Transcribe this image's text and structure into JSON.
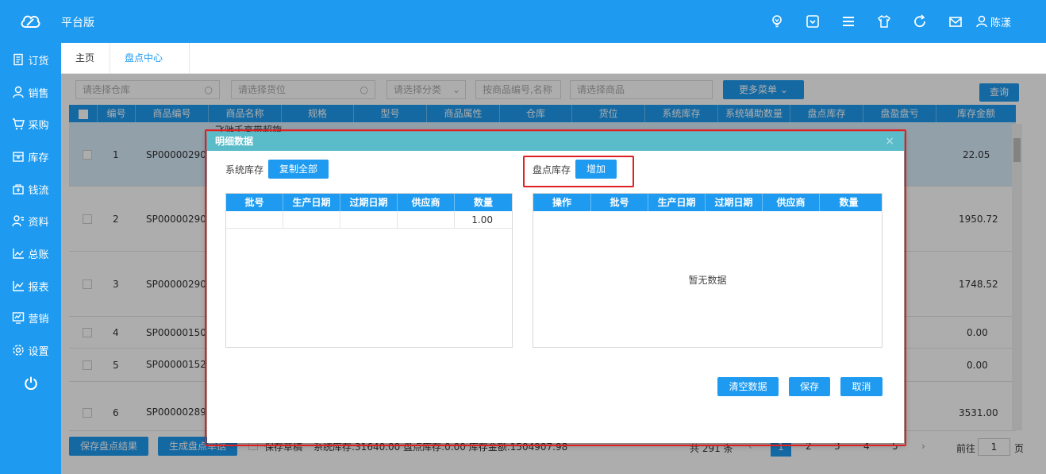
{
  "header": {
    "app_title": "平台版",
    "user_name": "陈漾",
    "icons": [
      "bulb-icon",
      "dropdown-box-icon",
      "menu-icon",
      "shirt-icon",
      "refresh-icon",
      "mail-icon",
      "user-icon"
    ]
  },
  "sidebar": {
    "items": [
      {
        "label": "订货",
        "icon": "order-icon"
      },
      {
        "label": "销售",
        "icon": "sales-icon"
      },
      {
        "label": "采购",
        "icon": "cart-icon"
      },
      {
        "label": "库存",
        "icon": "inventory-icon"
      },
      {
        "label": "钱流",
        "icon": "money-icon"
      },
      {
        "label": "资料",
        "icon": "profile-icon"
      },
      {
        "label": "总账",
        "icon": "ledger-icon"
      },
      {
        "label": "报表",
        "icon": "report-icon"
      },
      {
        "label": "营销",
        "icon": "marketing-icon"
      },
      {
        "label": "设置",
        "icon": "gear-icon"
      }
    ],
    "power_icon": "power-icon"
  },
  "tabs": {
    "home": "主页",
    "active": "盘点中心",
    "close": "×"
  },
  "filters": {
    "warehouse": "请选择仓库",
    "location": "请选择货位",
    "category": "请选择分类",
    "code_name": "按商品编号,名称",
    "product": "请选择商品",
    "more_menu": "更多菜单",
    "query": "查询"
  },
  "grid": {
    "columns": [
      "编号",
      "商品编号",
      "商品名称",
      "规格",
      "型号",
      "商品属性",
      "仓库",
      "货位",
      "系统库存",
      "系统辅助数量",
      "盘点库存",
      "盘盈盘亏",
      "库存金额"
    ],
    "partial_name": "飞驰千亮带超旋",
    "rows": [
      {
        "no": "1",
        "code": "SP00000290",
        "amount": "22.05"
      },
      {
        "no": "2",
        "code": "SP00000290",
        "amount": "1950.72"
      },
      {
        "no": "3",
        "code": "SP00000290",
        "amount": "1748.52"
      },
      {
        "no": "4",
        "code": "SP00000150",
        "amount": "0.00"
      },
      {
        "no": "5",
        "code": "SP00000152",
        "amount": "0.00"
      },
      {
        "no": "6",
        "code": "SP00000289",
        "amount": "3531.00"
      }
    ]
  },
  "footer": {
    "save_result": "保存盘点结果",
    "generate": "生成盘点单据",
    "draft": "保存草稿",
    "summary": "系统库存:31640.00  盘点库存:0.00  库存金额:1504907.98",
    "total": "共 291 条",
    "pages": [
      "1",
      "2",
      "3",
      "4",
      "5"
    ],
    "goto": "前往",
    "page_input": "1",
    "page_unit": "页"
  },
  "modal": {
    "title": "明细数据",
    "close": "×",
    "left_label": "系统库存",
    "copy_all": "复制全部",
    "right_label": "盘点库存",
    "add": "增加",
    "left_columns": [
      "批号",
      "生产日期",
      "过期日期",
      "供应商",
      "数量"
    ],
    "left_rows": [
      {
        "qty": "1.00"
      }
    ],
    "right_columns": [
      "操作",
      "批号",
      "生产日期",
      "过期日期",
      "供应商",
      "数量"
    ],
    "empty": "暂无数据",
    "clear": "清空数据",
    "save": "保存",
    "cancel": "取消"
  }
}
